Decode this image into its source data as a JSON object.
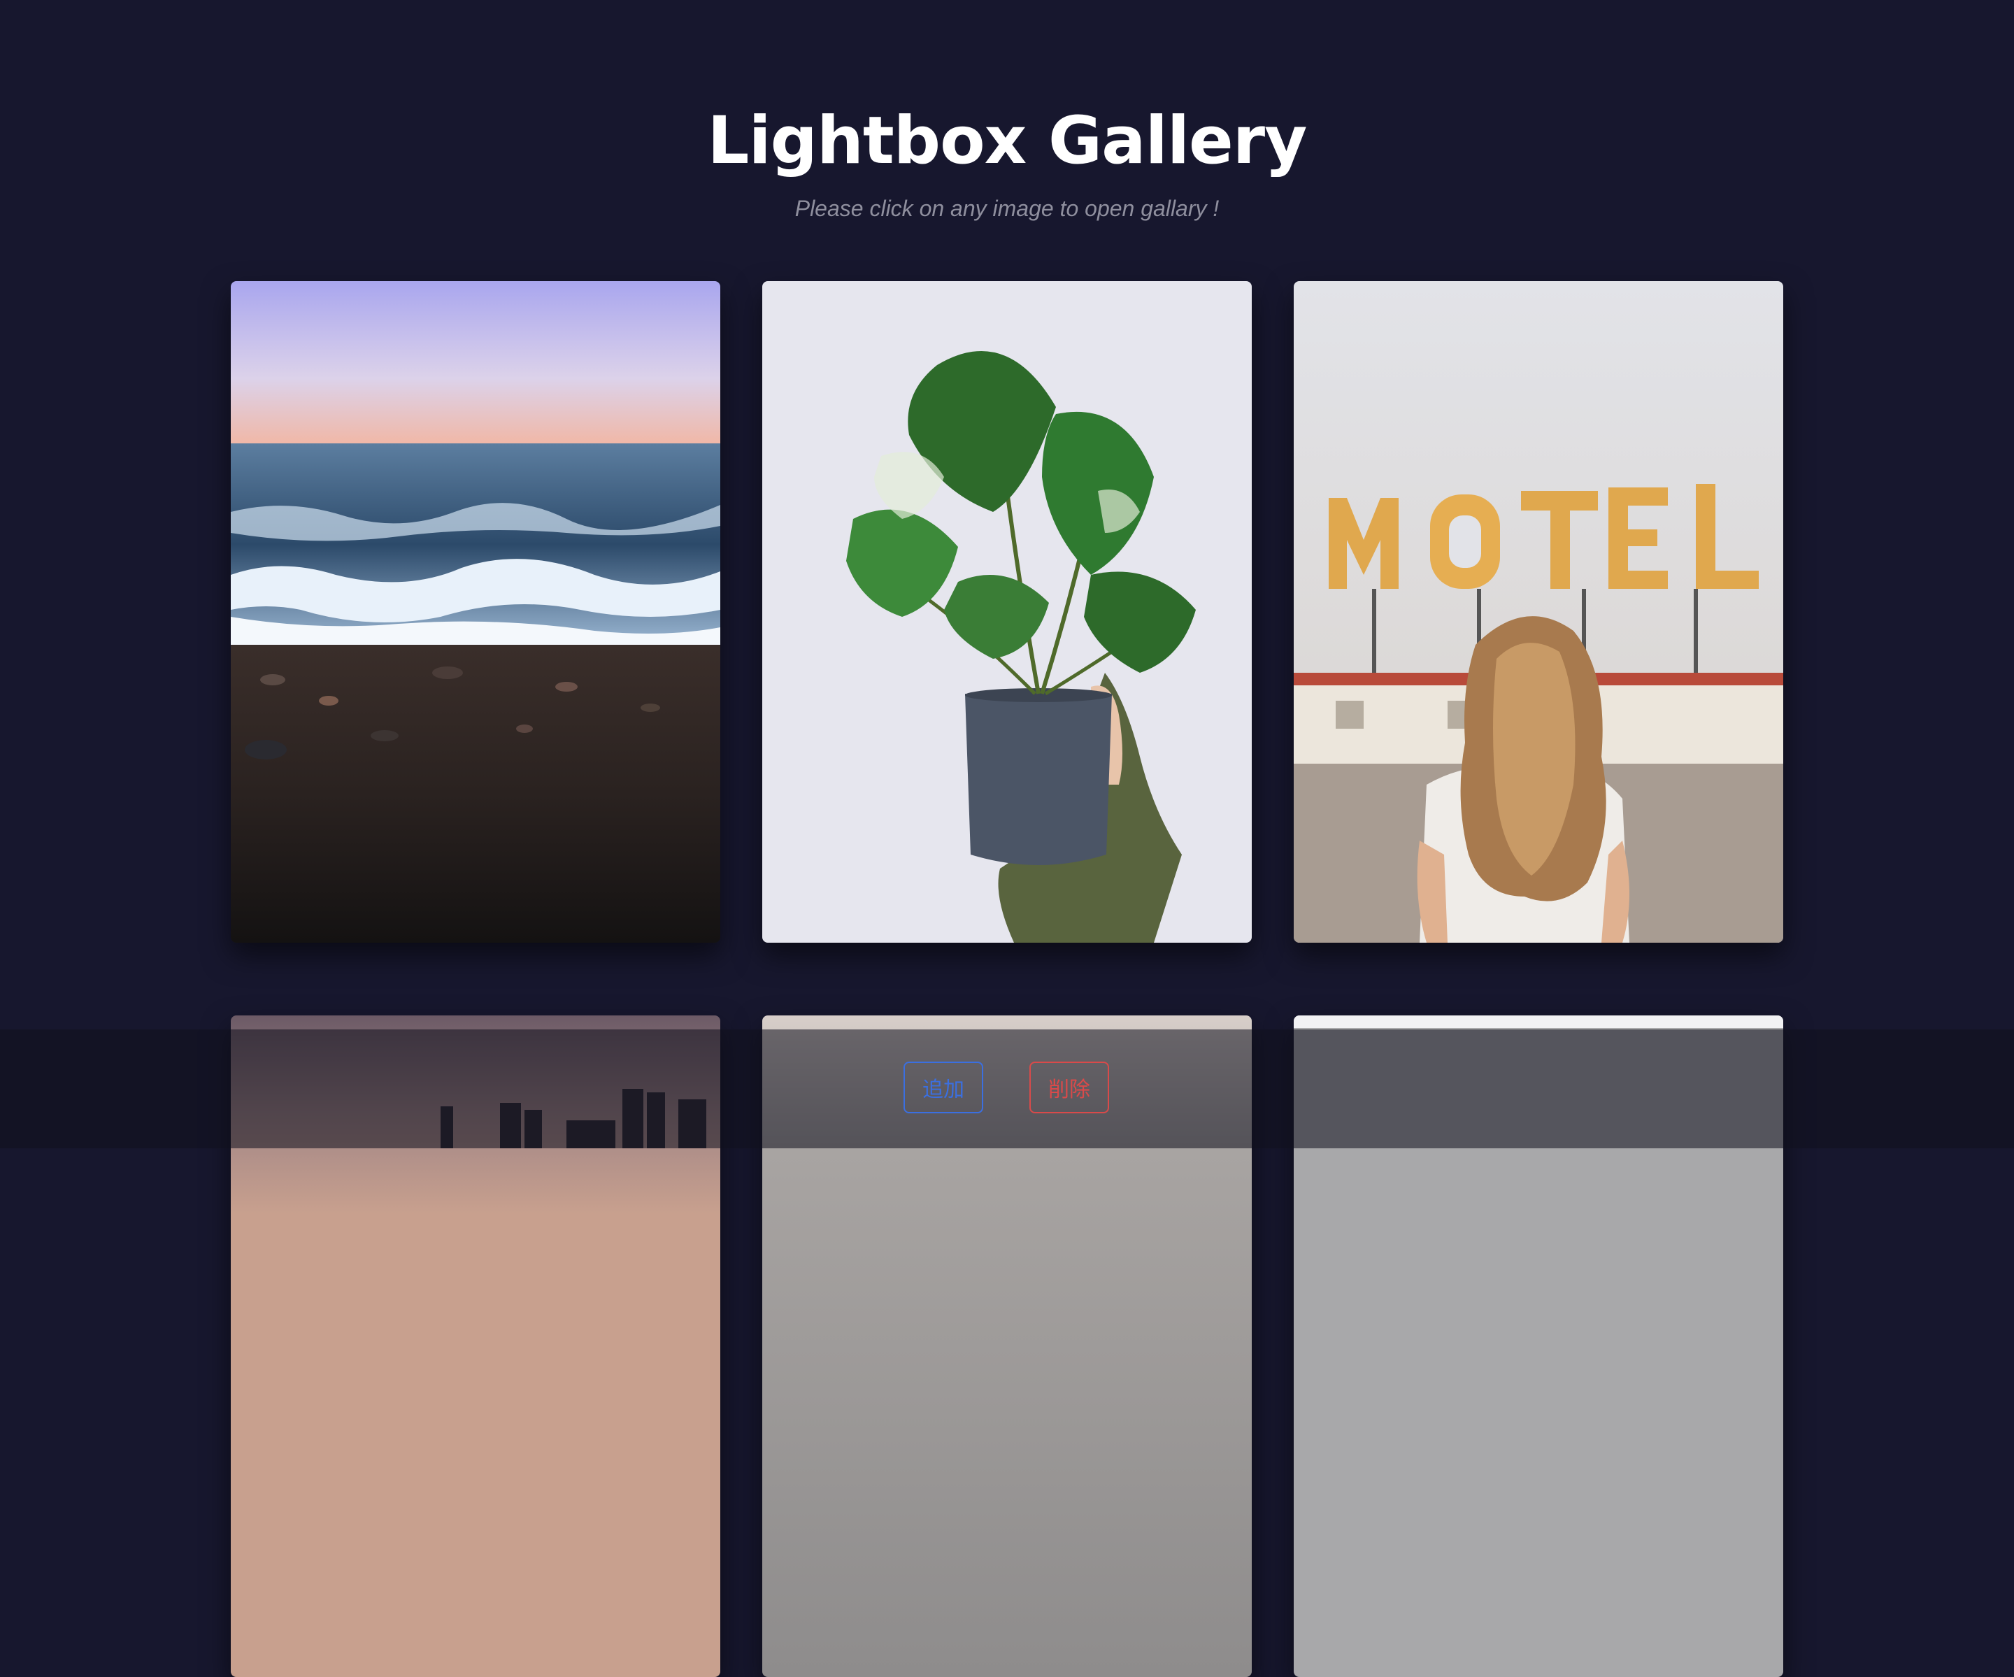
{
  "header": {
    "title": "Lightbox Gallery",
    "subtitle": "Please click on any image to open gallary !"
  },
  "gallery": {
    "images": [
      {
        "name": "beach-shore",
        "description": "sea waves on pebble beach at dusk"
      },
      {
        "name": "monstera-plant",
        "description": "person holding potted monstera plant"
      },
      {
        "name": "motel-sign",
        "description": "woman with long hair facing motel sign"
      },
      {
        "name": "city-skyline",
        "description": "city skyline at sunset"
      },
      {
        "name": "gray-sky",
        "description": "cloudy gray image"
      },
      {
        "name": "gray-blank",
        "description": "gray image"
      }
    ]
  },
  "toolbar": {
    "add_label": "追加",
    "delete_label": "削除"
  },
  "colors": {
    "background": "#17172e",
    "add_button": "#3b6fe0",
    "delete_button": "#d94a4a"
  }
}
